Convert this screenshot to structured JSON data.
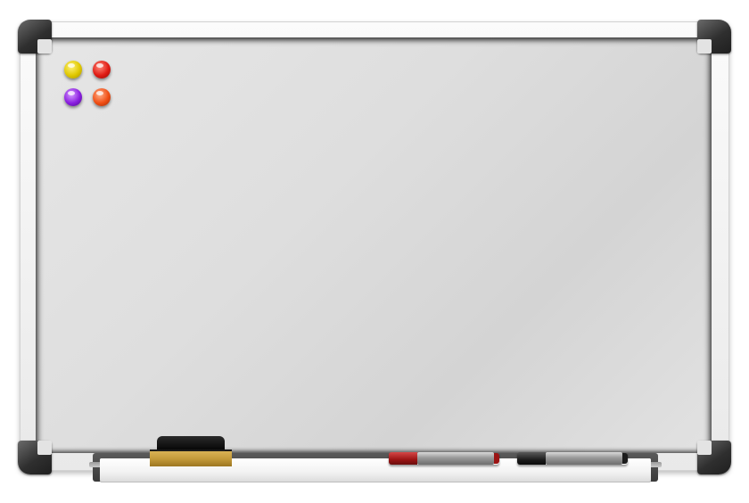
{
  "scene": {
    "object": "whiteboard",
    "board_color": "#dedede",
    "frame_color": "#f2f2f2",
    "corner_color": "#2f2f2f"
  },
  "magnets": [
    {
      "color": "#e0c800",
      "name": "yellow"
    },
    {
      "color": "#e01b14",
      "name": "red"
    },
    {
      "color": "#8a1ee0",
      "name": "purple"
    },
    {
      "color": "#f04e14",
      "name": "orange"
    }
  ],
  "tray_items": {
    "eraser": {
      "felt_color": "#c49a3a",
      "handle_color": "#0a0a0a"
    },
    "markers": [
      {
        "cap_color": "#9b1414",
        "name": "red"
      },
      {
        "cap_color": "#1c1c1c",
        "name": "black"
      }
    ]
  }
}
